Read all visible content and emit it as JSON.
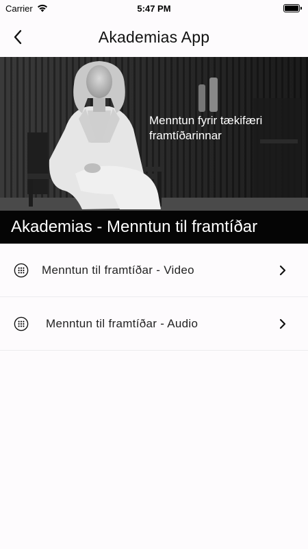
{
  "status_bar": {
    "carrier": "Carrier",
    "time": "5:47 PM"
  },
  "nav": {
    "title": "Akademias App",
    "back_icon": "chevron-left-icon"
  },
  "hero": {
    "caption_line1": "Menntun fyrir tækifæri",
    "caption_line2": "framtíðarinnar",
    "banner_title": "Akademias - Menntun til framtíðar"
  },
  "list": {
    "items": [
      {
        "label": "Menntun til framtíðar - Video",
        "icon": "grid-dots-icon"
      },
      {
        "label": "Menntun til framtíðar - Audio",
        "icon": "grid-dots-icon"
      }
    ]
  },
  "colors": {
    "background": "#fdfbfd",
    "banner": "#050505",
    "divider": "#ecebee"
  }
}
